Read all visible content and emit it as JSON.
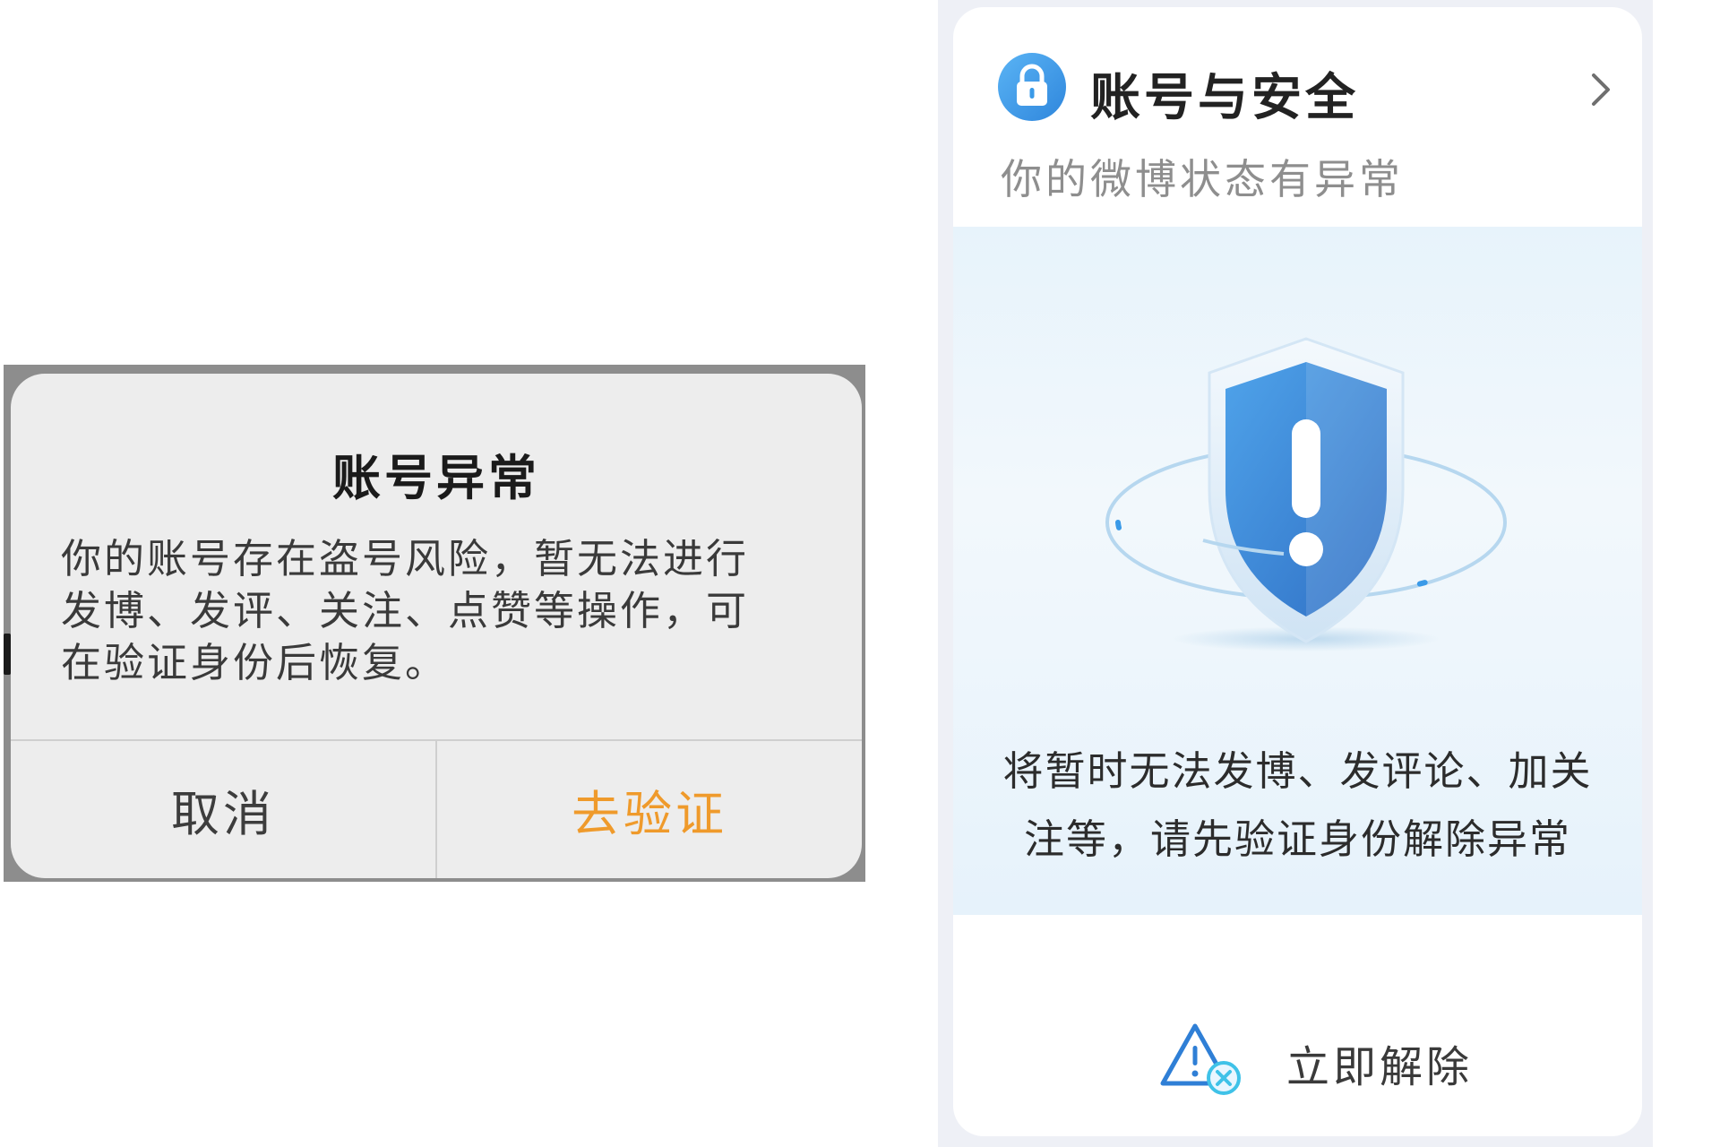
{
  "alert_dialog": {
    "title": "账号异常",
    "message_lines": [
      "你的账号存在盗号风险，暂无法进行",
      "发博、发评、关注、点赞等操作，可",
      "在验证身份后恢复。"
    ],
    "cancel_label": "取消",
    "confirm_label": "去验证",
    "confirm_color": "#ef9a2b"
  },
  "security_card": {
    "title": "账号与安全",
    "subtitle": "你的微博状态有异常",
    "notice_lines": [
      "将暂时无法发博、发评论、加关",
      "注等，请先验证身份解除异常"
    ],
    "resolve_label": "立即解除",
    "icons": {
      "header": "lock-icon",
      "hero": "shield-warning-icon",
      "action": "warning-cancel-icon",
      "navigation": "chevron-right-icon"
    },
    "accent_color": "#3a9ae8"
  }
}
